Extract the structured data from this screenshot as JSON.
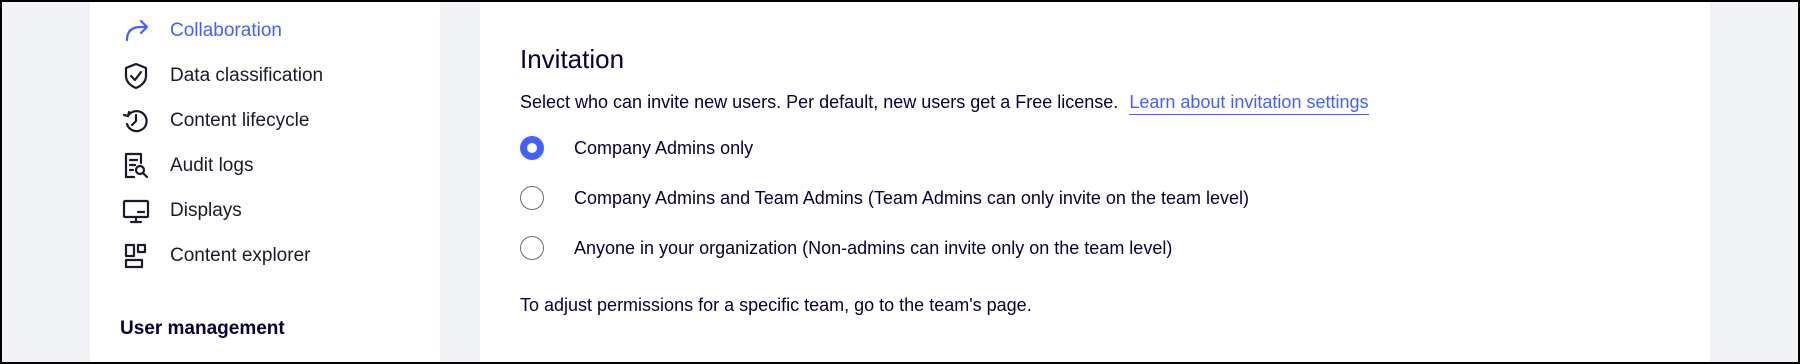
{
  "sidebar": {
    "items": [
      {
        "label": "Collaboration",
        "icon": "share-arrow-icon",
        "active": true
      },
      {
        "label": "Data classification",
        "icon": "shield-check-icon",
        "active": false
      },
      {
        "label": "Content lifecycle",
        "icon": "history-clock-icon",
        "active": false
      },
      {
        "label": "Audit logs",
        "icon": "document-search-icon",
        "active": false
      },
      {
        "label": "Displays",
        "icon": "display-icon",
        "active": false
      },
      {
        "label": "Content explorer",
        "icon": "layout-grid-icon",
        "active": false
      }
    ],
    "section_heading": "User management"
  },
  "main": {
    "title": "Invitation",
    "description": "Select who can invite new users. Per default, new users get a Free license.",
    "learn_link": "Learn about invitation settings",
    "options": [
      {
        "label": "Company Admins only",
        "checked": true
      },
      {
        "label": "Company Admins and Team Admins (Team Admins can only invite on the team level)",
        "checked": false
      },
      {
        "label": "Anyone in your organization (Non-admins can invite only on the team level)",
        "checked": false
      }
    ],
    "footnote": "To adjust permissions for a specific team, go to the team's page."
  },
  "colors": {
    "accent": "#4262ff",
    "text": "#050038",
    "background": "#f1f2f5"
  }
}
